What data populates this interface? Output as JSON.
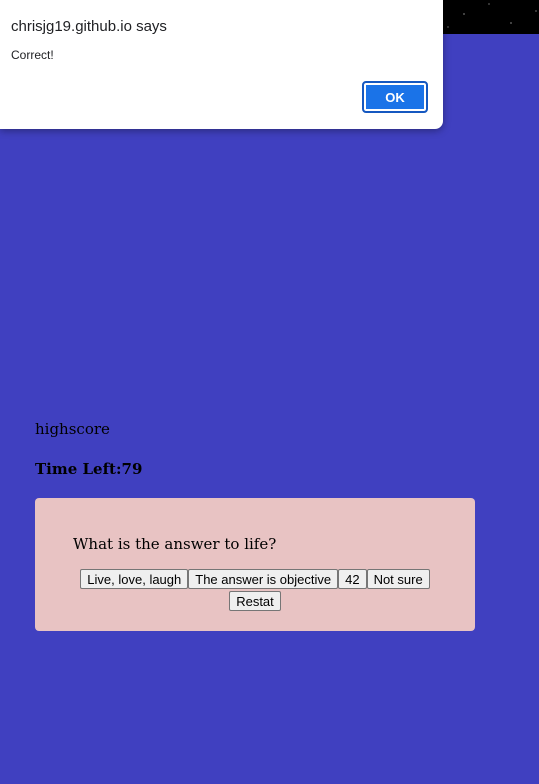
{
  "dialog": {
    "title": "chrisjg19.github.io says",
    "message": "Correct!",
    "ok_label": "OK"
  },
  "page": {
    "highscore_label": "highscore",
    "time_left": "Time Left:79"
  },
  "quiz": {
    "question": "What is the answer to life?",
    "answers": [
      "Live, love, laugh",
      "The answer is objective",
      "42",
      "Not sure"
    ],
    "restart_label": "Restat"
  },
  "colors": {
    "background": "#4040c0",
    "card": "#e8c3c3",
    "dialog_button": "#1a73e8"
  }
}
